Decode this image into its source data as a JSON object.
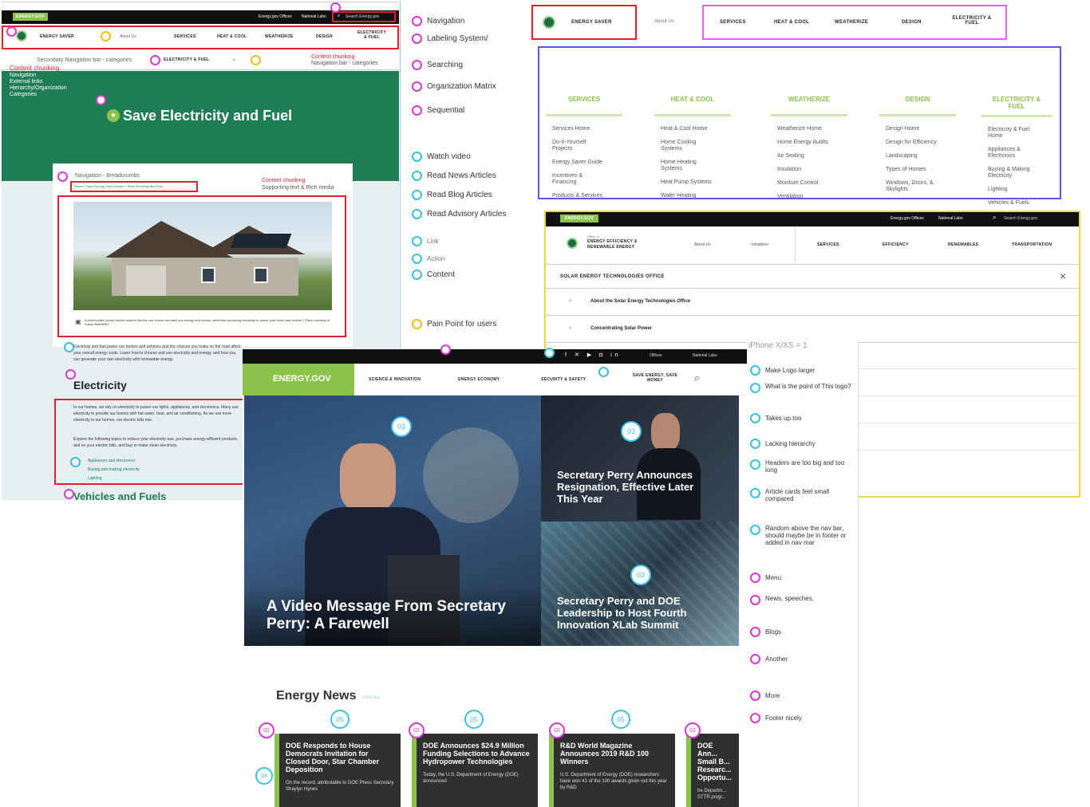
{
  "legend_top": [
    "Navigation",
    "Labeling System/",
    "Searching",
    "Organization Matrix",
    "Sequential"
  ],
  "legend_mid": [
    "Watch video",
    "Read News Articles",
    "Read Blog Articles",
    "Read Advisory Articles"
  ],
  "legend_low": [
    "Link",
    "Action",
    "Content"
  ],
  "legend_pain": "Pain Point for users",
  "p1": {
    "logo": "ENERGY.GOV",
    "util_links": [
      "Energy.gov Offices",
      "National Labs"
    ],
    "search_placeholder": "Search Energy.gov",
    "site_name": "ENERGY SAVER",
    "about": "About Us",
    "nav": [
      "SERVICES",
      "HEAT & COOL",
      "WEATHERIZE",
      "DESIGN",
      "ELECTRICITY & FUEL"
    ],
    "secondary_label": "Secondary Navigation bar - categories",
    "secondary_current": "ELECTRICITY & FUEL",
    "content_chunking_1": "Content chunking",
    "chunk_list": [
      "Navigation",
      "External links",
      "Hierarchy/Organization",
      "Categories"
    ],
    "content_chunking_2": "Content chunking",
    "nav_categories": "Navigation bar - categories",
    "hero_title": "Save Electricity and Fuel",
    "breadcrumb_label": "Navigation - Breadcrumbs",
    "breadcrumb": "Home » Save Energy, Save Money » Save Electricity and Fuel",
    "content_chunking_3": "Content chunking",
    "supporting": "Supporting text & Rich media",
    "caption": "A photovoltaic (solar) electric system like the one shown can save you energy and money, while also producing electricity to power your home and vehicle. | Photo courtesy of Susan Bilo/NREL",
    "intro": "Electricity and fuel power our homes and vehicles and the choices you make on the road affect your overall energy costs. Learn how to choose and use electricity and energy, and how you can generate your own electricity with renewable energy.",
    "section_title": "Electricity",
    "section_text": "In our homes, we rely on electricity to power our lights, appliances, and electronics. Many use electricity to provide our homes with hot water, heat, and air conditioning. As we use more electricity in our homes, our electric bills rise.",
    "section_text2": "Explore the following topics to reduce your electricity use, purchase energy-efficient products, and on your electric bills, and buy or make clean electricity.",
    "links": [
      "Appliances and electronics",
      "Buying and making electricity",
      "Lighting"
    ],
    "next_title": "Vehicles and Fuels"
  },
  "p2": {
    "site_name": "ENERGY SAVER",
    "about": "About Us",
    "nav": [
      "SERVICES",
      "HEAT & COOL",
      "WEATHERIZE",
      "DESIGN",
      "ELECTRICITY & FUEL"
    ],
    "columns": [
      {
        "head": "SERVICES",
        "items": [
          "Services Home",
          "Do-It-Yourself Projects",
          "Energy Saver Guide",
          "Incentives & Financing",
          "Products & Services"
        ]
      },
      {
        "head": "HEAT & COOL",
        "items": [
          "Heat & Cool Home",
          "Home Cooling Systems",
          "Home Heating Systems",
          "Heat Pump Systems",
          "Water Heating"
        ]
      },
      {
        "head": "WEATHERIZE",
        "items": [
          "Weatherize Home",
          "Home Energy Audits",
          "Air Sealing",
          "Insulation",
          "Moisture Control",
          "Ventilation"
        ]
      },
      {
        "head": "DESIGN",
        "items": [
          "Design Home",
          "Design for Efficiency",
          "Landscaping",
          "Types of Homes",
          "Windows, Doors, & Skylights"
        ]
      },
      {
        "head": "ELECTRICITY & FUEL",
        "items": [
          "Electricity & Fuel Home",
          "Appliances & Electronics",
          "Buying & Making Electricity",
          "Lighting",
          "Vehicles & Fuels"
        ]
      }
    ]
  },
  "p3": {
    "logo": "ENERGY.GOV",
    "util_links": [
      "Energy.gov Offices",
      "National Labs"
    ],
    "search_placeholder": "Search Energy.gov",
    "office_of": "Office of",
    "office_name": "ENERGY EFFICIENCY & RENEWABLE ENERGY",
    "nav_left": [
      "About Us",
      "Initiatives"
    ],
    "nav": [
      "SERVICES",
      "EFFICIENCY",
      "RENEWABLES",
      "TRANSPORTATION"
    ],
    "panel_title": "SOLAR ENERGY TECHNOLOGIES OFFICE",
    "rows": [
      "About the Solar Energy Technologies Office",
      "Concentrating Solar Power"
    ],
    "device_label": "iPhone X/XS = 1"
  },
  "main": {
    "util_links": [
      "Offices",
      "National Labs"
    ],
    "logo": "ENERGY.GOV",
    "nav": [
      "SCIENCE & INNOVATION",
      "ENERGY ECONOMY",
      "SECURITY & SAFETY",
      "SAVE ENERGY, SAVE MONEY"
    ],
    "hero_main": "A Video Message From Secretary Perry: A Farewell",
    "hero_side1": "Secretary Perry Announces Resignation, Effective Later This Year",
    "hero_side2": "Secretary Perry and DOE Leadership to Host Fourth Innovation XLab Summit",
    "news_title": "Energy News",
    "view_all": "VIEW ALL",
    "cards": [
      {
        "title": "DOE Responds to House Democrats Invitation for Closed Door, Star Chamber Deposition",
        "snippet": "On the record, attributable to DOE Press Secretary Shaylyn Hynes"
      },
      {
        "title": "DOE Announces $24.9 Million Funding Selections to Advance Hydropower Technologies",
        "snippet": "Today, the U.S. Department of Energy (DOE) announced"
      },
      {
        "title": "R&D World Magazine Announces 2019 R&D 100 Winners",
        "snippet": "U.S. Department of Energy (DOE) researchers have won 41 of the 100 awards given out this year by R&D"
      },
      {
        "title": "DOE Ann... Small B... Researc... Opportu...",
        "snippet": "he Departm... STTR progr..."
      }
    ]
  },
  "notes": [
    "Make Logo larger",
    "What is the point of This logo?",
    "Takes up too",
    "Lacking hierarchy",
    "Headers are too big and too long",
    "Article cards feel small compared",
    "Random above the nav bar, should maybe be in footer or added in nav mar",
    "Menu",
    "News, speeches,",
    "Blogs",
    "Another",
    "More",
    "Footer nicely"
  ],
  "pin_numbers": {
    "a": "01",
    "b": "02",
    "c": "03",
    "d": "04",
    "e": "05"
  },
  "colors": {
    "green": "#8bc34a",
    "dark_green": "#1f7d55",
    "annotation_red": "#e0202a",
    "pin_magenta": "#d63ad6",
    "pin_cyan": "#3cc0e0",
    "purple_box": "#6a4cf0",
    "pink_box": "#e262e0",
    "yellow_box": "#eadc3a"
  }
}
